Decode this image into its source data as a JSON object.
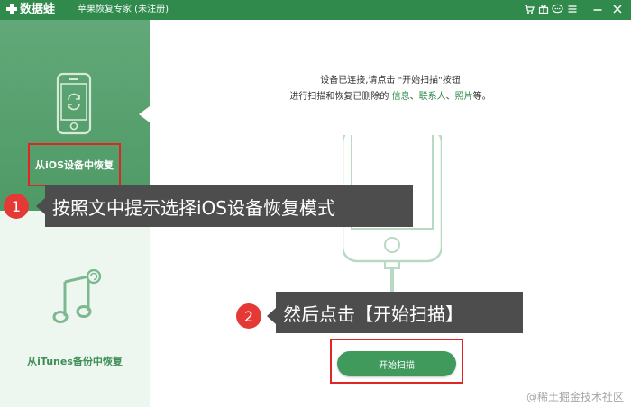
{
  "titlebar": {
    "app_name": "数据蛙",
    "window_title": "苹果恢复专家 (未注册)",
    "icons": [
      "cart-icon",
      "gift-icon",
      "chat-icon",
      "menu-icon",
      "minimize-icon",
      "close-icon"
    ]
  },
  "sidebar": {
    "modes": [
      {
        "label": "从iOS设备中恢复",
        "icon": "iphone-icon",
        "selected": true
      },
      {
        "label": "从iTunes备份中恢复",
        "icon": "itunes-icon",
        "selected": false
      }
    ]
  },
  "main": {
    "instruction_line1": "设备已连接,请点击 \"开始扫描\"按钮",
    "instruction_line2_prefix": "进行扫描和恢复已删除的 ",
    "link_info": "信息",
    "sep1": "、",
    "link_contacts": "联系人",
    "sep2": "、",
    "link_photos": "照片",
    "instruction_line2_suffix": "等。",
    "start_scan_label": "开始扫描"
  },
  "annotations": [
    {
      "number": "1",
      "text": "按照文中提示选择iOS设备恢复模式"
    },
    {
      "number": "2",
      "text": "然后点击【开始扫描】"
    }
  ],
  "watermark": "@稀土掘金技术社区",
  "colors": {
    "brand_green": "#2f8a4c",
    "sidebar_selected": "#55a06c",
    "button_green": "#3f9a5c",
    "highlight_red": "#e02525",
    "annotation_badge": "#e53935",
    "annotation_bg": "#4d4d4d"
  }
}
